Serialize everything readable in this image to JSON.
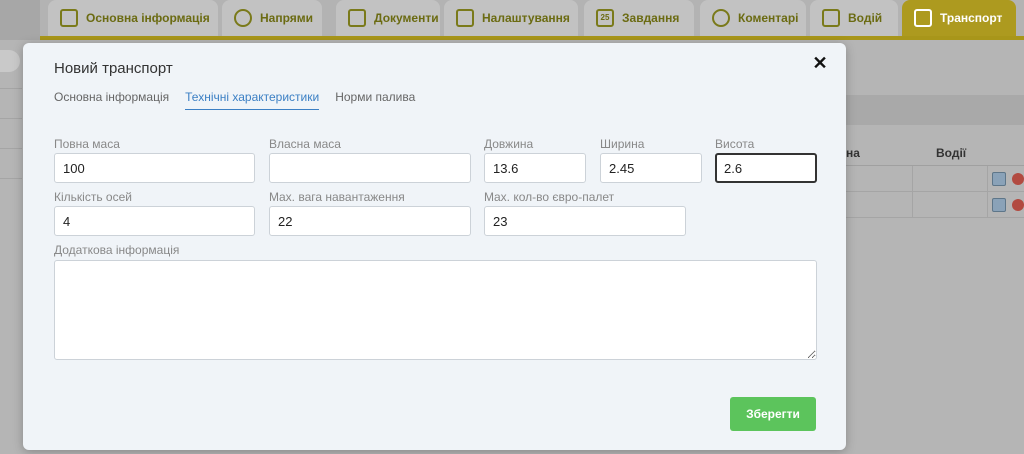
{
  "app_tabs": [
    {
      "label": "Основна інформація",
      "icon": "panel-icon"
    },
    {
      "label": "Напрями",
      "icon": "chat-bubble-icon"
    },
    {
      "label": "Документи",
      "icon": "document-icon"
    },
    {
      "label": "Налаштування",
      "icon": "settings-panel-icon"
    },
    {
      "label": "Завдання",
      "icon": "calendar-icon",
      "icon_text": "25"
    },
    {
      "label": "Коментарі",
      "icon": "chat-bubble-icon"
    },
    {
      "label": "Водій",
      "icon": "bus-icon"
    },
    {
      "label": "Транспорт",
      "icon": "truck-icon",
      "active": true
    }
  ],
  "bg_table": {
    "headers": [
      "на",
      "Водії"
    ]
  },
  "modal": {
    "title": "Новий транспорт",
    "tabs": [
      {
        "label": "Основна інформація"
      },
      {
        "label": "Технічні характеристики",
        "active": true
      },
      {
        "label": "Норми палива"
      }
    ],
    "fields": {
      "gross_mass": {
        "label": "Повна маса",
        "value": "100"
      },
      "own_mass": {
        "label": "Власна маса",
        "value": ""
      },
      "length": {
        "label": "Довжина",
        "value": "13.6"
      },
      "width": {
        "label": "Ширина",
        "value": "2.45"
      },
      "height": {
        "label": "Висота",
        "value": "2.6"
      },
      "axles": {
        "label": "Кількість осей",
        "value": "4"
      },
      "max_load": {
        "label": "Max. вага навантаження",
        "value": "22"
      },
      "max_pallets": {
        "label": "Max. кол-во євро-палет",
        "value": "23"
      },
      "additional_info": {
        "label": "Додаткова інформація",
        "value": ""
      }
    },
    "save_label": "Зберегти",
    "close_glyph": "✕"
  },
  "colors": {
    "accent_tab": "#ad9a1f",
    "tab_text": "#6b6b12",
    "save_button": "#5cc45c",
    "active_tab_link": "#3b7fc4"
  }
}
